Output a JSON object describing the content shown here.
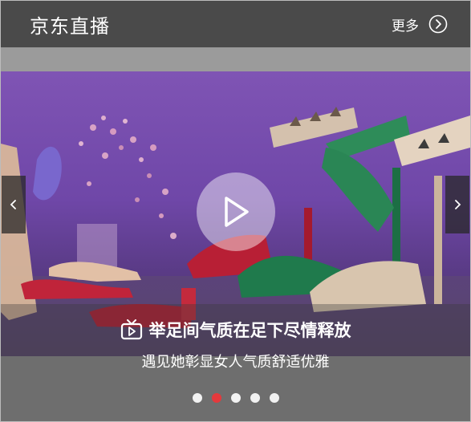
{
  "header": {
    "title": "京东直播",
    "more_label": "更多"
  },
  "slide": {
    "headline": "举足间气质在足下尽情释放",
    "subline": "遇见她彰显女人气质舒适优雅"
  },
  "carousel": {
    "total": 5,
    "active_index": 1,
    "active_color": "#e4393c"
  },
  "icons": {
    "more": "chevron-right-circle-icon",
    "play": "play-icon",
    "prev": "chevron-left-icon",
    "next": "chevron-right-icon",
    "live": "tv-icon"
  }
}
